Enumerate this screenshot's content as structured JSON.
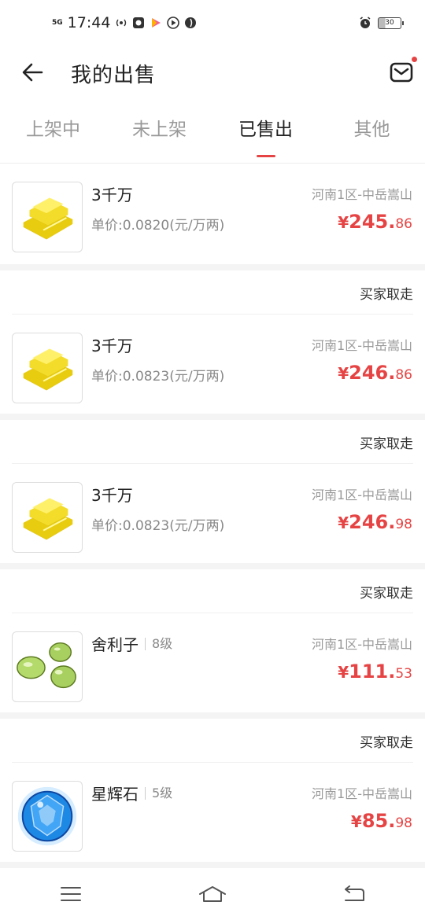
{
  "status_bar": {
    "signal": "5G",
    "time": "17:44",
    "battery": "30"
  },
  "header": {
    "title": "我的出售"
  },
  "tabs": [
    {
      "label": "上架中",
      "active": false
    },
    {
      "label": "未上架",
      "active": false
    },
    {
      "label": "已售出",
      "active": true
    },
    {
      "label": "其他",
      "active": false
    }
  ],
  "orders": [
    {
      "status": "",
      "icon": "gold-bars-icon",
      "name": "3千万",
      "level": "",
      "unit_price": "单价:0.0820(元/万两)",
      "server": "河南1区-中岳嵩山",
      "price_yen": "¥",
      "price_int": "245.",
      "price_dec": "86"
    },
    {
      "status": "买家取走",
      "icon": "gold-bars-icon",
      "name": "3千万",
      "level": "",
      "unit_price": "单价:0.0823(元/万两)",
      "server": "河南1区-中岳嵩山",
      "price_yen": "¥",
      "price_int": "246.",
      "price_dec": "86"
    },
    {
      "status": "买家取走",
      "icon": "gold-bars-icon",
      "name": "3千万",
      "level": "",
      "unit_price": "单价:0.0823(元/万两)",
      "server": "河南1区-中岳嵩山",
      "price_yen": "¥",
      "price_int": "246.",
      "price_dec": "98"
    },
    {
      "status": "买家取走",
      "icon": "green-relic-icon",
      "name": "舍利子",
      "level": "8级",
      "unit_price": "",
      "server": "河南1区-中岳嵩山",
      "price_yen": "¥",
      "price_int": "111.",
      "price_dec": "53"
    },
    {
      "status": "买家取走",
      "icon": "blue-gem-icon",
      "name": "星辉石",
      "level": "5级",
      "unit_price": "",
      "server": "河南1区-中岳嵩山",
      "price_yen": "¥",
      "price_int": "85.",
      "price_dec": "98"
    }
  ],
  "nav": {
    "menu": "menu-icon",
    "home": "home-icon",
    "back": "back-icon"
  }
}
